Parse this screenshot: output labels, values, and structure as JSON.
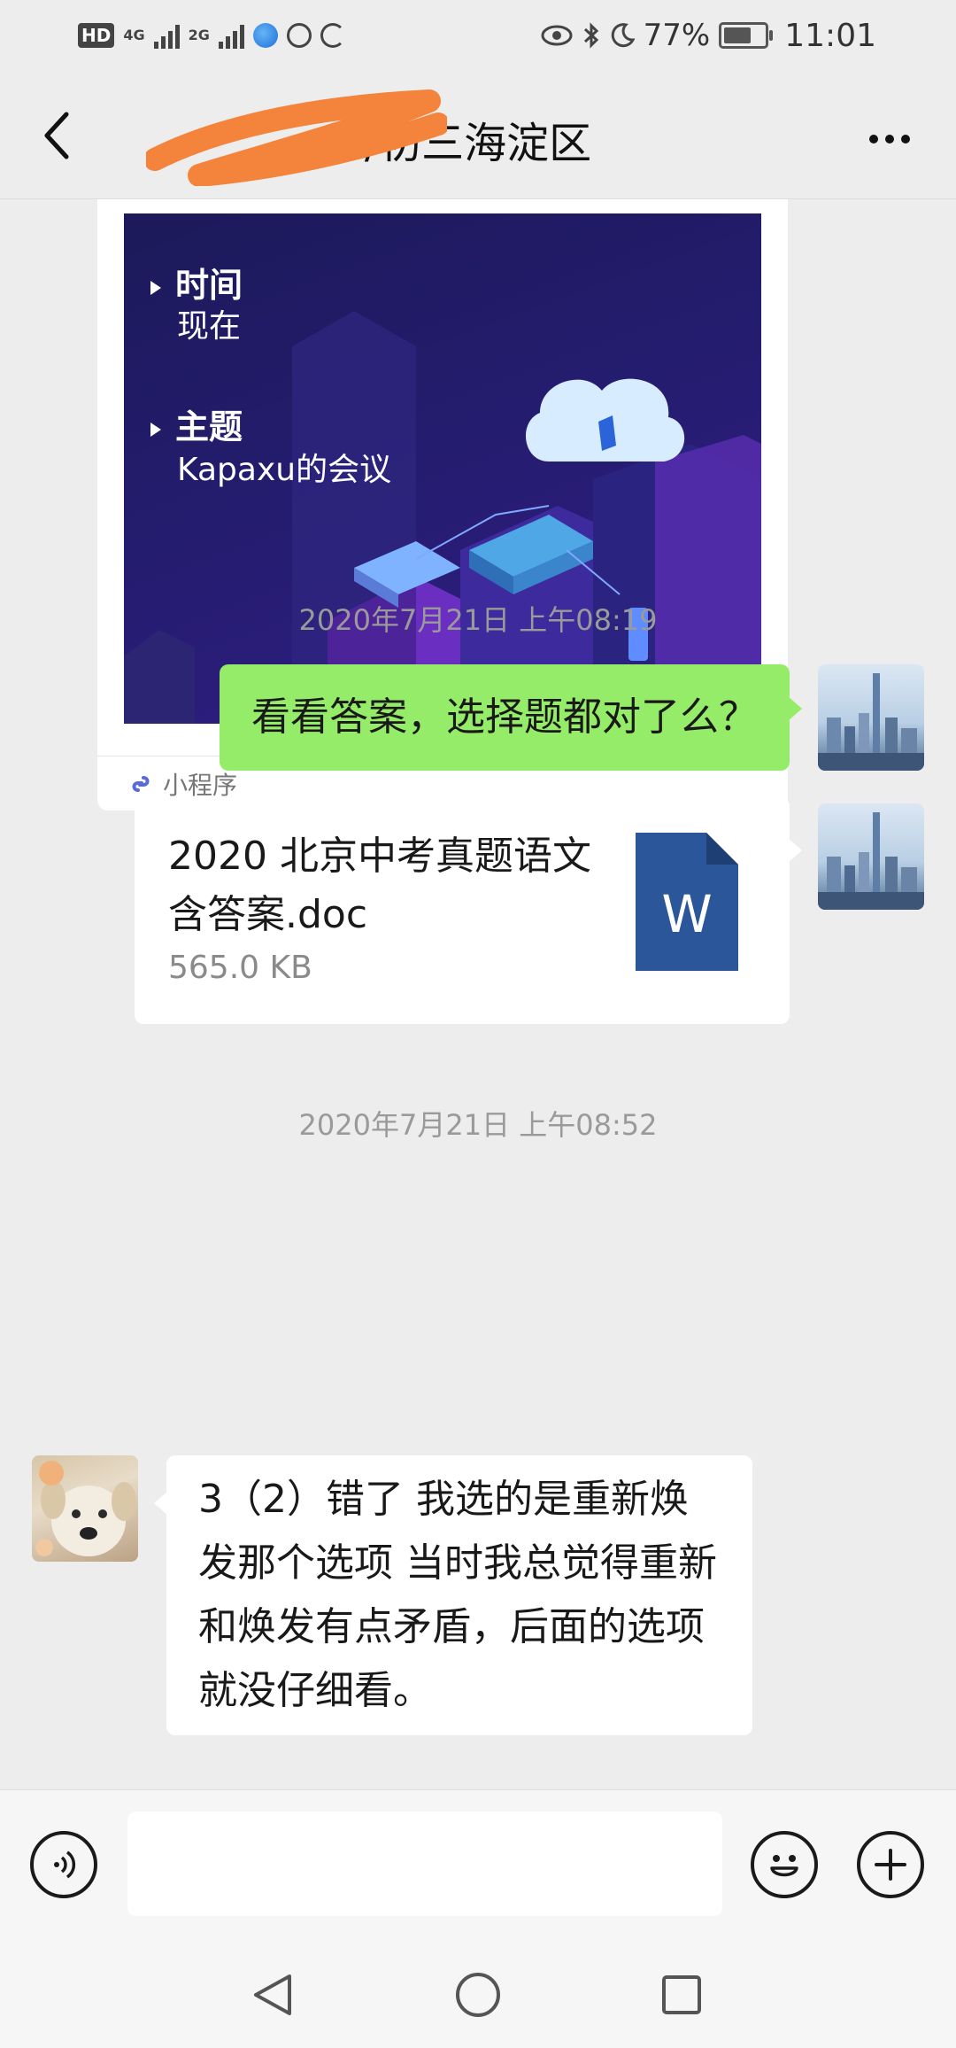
{
  "status_bar": {
    "network_1": "4G",
    "network_2": "2G",
    "battery": "77%",
    "battery_level": 0.77,
    "time": "11:01"
  },
  "header": {
    "title": "/初三海淀区",
    "back_icon": "chevron-left-icon",
    "more_icon": "more-dots-icon"
  },
  "mini_program": {
    "label_time": "时间",
    "value_time": "现在",
    "label_topic": "主题",
    "value_topic": "Kapaxu的会议",
    "footer": "小程序"
  },
  "messages": [
    {
      "type": "timestamp",
      "text": "2020年7月21日 上午08:19"
    },
    {
      "type": "text",
      "side": "out",
      "text": "看看答案，选择题都对了么？"
    },
    {
      "type": "file",
      "side": "out",
      "name": "2020 北京中考真题语文含答案.doc",
      "size": "565.0 KB",
      "icon": "W"
    },
    {
      "type": "timestamp",
      "text": "2020年7月21日 上午08:52"
    },
    {
      "type": "text",
      "side": "in",
      "text": "3（2）错了 我选的是重新焕发那个选项 当时我总觉得重新和焕发有点矛盾，后面的选项就没仔细看。"
    }
  ],
  "input_bar": {
    "placeholder": "",
    "voice_icon": "voice-icon",
    "emoji_icon": "emoji-icon",
    "plus_icon": "plus-icon"
  },
  "colors": {
    "accent_green": "#95ec69",
    "background": "#ededed",
    "word_blue": "#2b579a"
  }
}
